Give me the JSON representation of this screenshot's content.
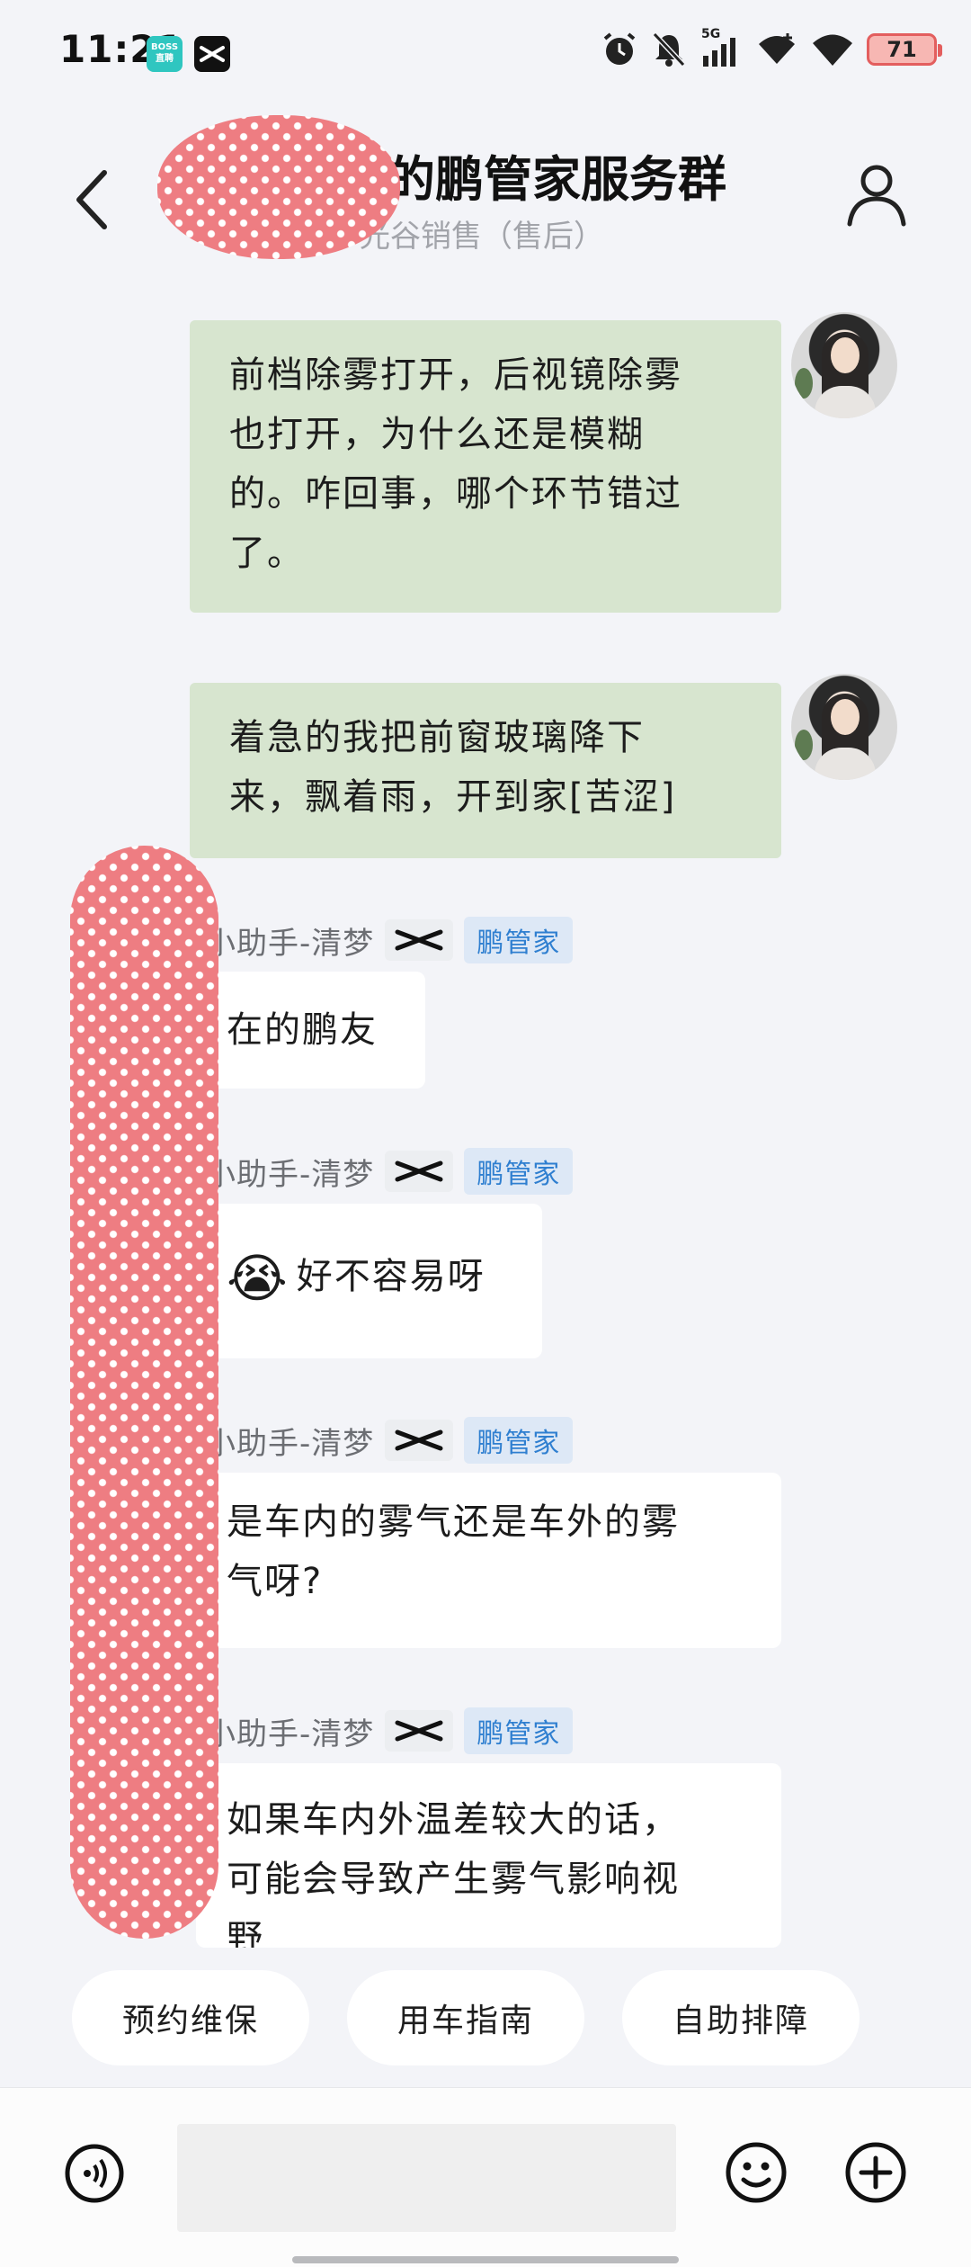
{
  "status_bar": {
    "time": "11:21",
    "boss_app_label": "BOSS\n直聘",
    "network": "5G",
    "battery": "71"
  },
  "header": {
    "title": "的鹏管家服务群",
    "subtitle": "光谷销售（售后）"
  },
  "messages": [
    {
      "type": "sent",
      "text": "前档除雾打开，后视镜除雾\n也打开，为什么还是模糊\n的。咋回事，哪个环节错过\n了。"
    },
    {
      "type": "sent",
      "text": "着急的我把前窗玻璃降下\n来，飘着雨，开到家[苦涩]"
    },
    {
      "type": "received",
      "sender": "小助手-清梦",
      "role": "鹏管家",
      "text": "在的鹏友"
    },
    {
      "type": "received",
      "sender": "小助手-清梦",
      "role": "鹏管家",
      "emoji": "😭",
      "text": "好不容易呀"
    },
    {
      "type": "received",
      "sender": "小助手-清梦",
      "role": "鹏管家",
      "text": "是车内的雾气还是车外的雾\n气呀?"
    },
    {
      "type": "received",
      "sender": "小助手-清梦",
      "role": "鹏管家",
      "text": "如果车内外温差较大的话，\n可能会导致产生雾气影响视\n野"
    }
  ],
  "quick_actions": [
    "预约维保",
    "用车指南",
    "自助排障"
  ],
  "input": {
    "value": "",
    "placeholder": ""
  },
  "icons": {
    "back": "chevron-left-icon",
    "profile": "person-icon",
    "voice": "voice-icon",
    "emoji": "smiley-icon",
    "plus": "plus-circle-icon"
  },
  "colors": {
    "sent_bubble": "#d7e5cf",
    "received_bubble": "#ffffff",
    "role_tag_text": "#2f7fd0",
    "background": "#f3f4f8"
  }
}
